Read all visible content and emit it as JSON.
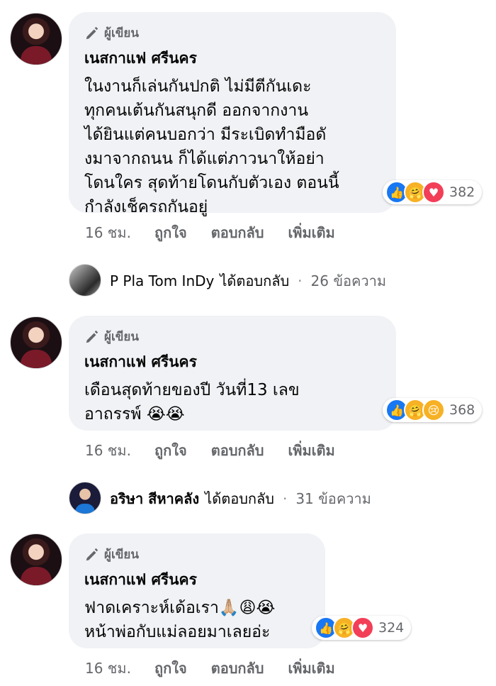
{
  "author_badge": "ผู้เขียน",
  "comments": [
    {
      "name": "เนสกาแฟ ศรีนคร",
      "text": "ในงานก็เล่นกันปกติ ไม่มีตีกันเดะ\nทุกคนเต้นกันสนุกดี ออกจากงาน\nได้ยินแต่คนบอกว่า มีระเบิดทำมือดั\nงมาจากถนน ก็ได้แต่ภาวนาให้อย่า\nโดนใคร สุดท้ายโดนกับตัวเอง ตอนนี้\nกำลังเช็ครถกันอยู่",
      "reactions": [
        "like-icon",
        "care-icon",
        "love-icon"
      ],
      "reaction_count": "382",
      "time": "16 ชม.",
      "like": "ถูกใจ",
      "reply": "ตอบกลับ",
      "more": "เพิ่มเติม"
    },
    {
      "name": "เนสกาแฟ ศรีนคร",
      "text": "เดือนสุดท้ายของปี วันที่13 เลข\nอาถรรพ์ 😭😭",
      "reactions": [
        "like-icon",
        "care-icon",
        "sad-icon"
      ],
      "reaction_count": "368",
      "time": "16 ชม.",
      "like": "ถูกใจ",
      "reply": "ตอบกลับ",
      "more": "เพิ่มเติม"
    },
    {
      "name": "เนสกาแฟ ศรีนคร",
      "text": "ฟาดเคราะห์เด้อเรา🙏🏼😩😭\nหน้าพ่อกับแม่ลอยมาเลยอ่ะ",
      "reactions": [
        "like-icon",
        "care-icon",
        "love-icon"
      ],
      "reaction_count": "324",
      "time": "16 ชม.",
      "like": "ถูกใจ",
      "reply": "ตอบกลับ",
      "more": "เพิ่มเติม"
    }
  ],
  "replies": [
    {
      "name": "P Pla Tom InDy",
      "replied": "ได้ตอบกลับ",
      "count": "26 ข้อความ"
    },
    {
      "name": "อริษา สีหาคลัง",
      "replied": "ได้ตอบกลับ",
      "count": "31 ข้อความ"
    }
  ]
}
